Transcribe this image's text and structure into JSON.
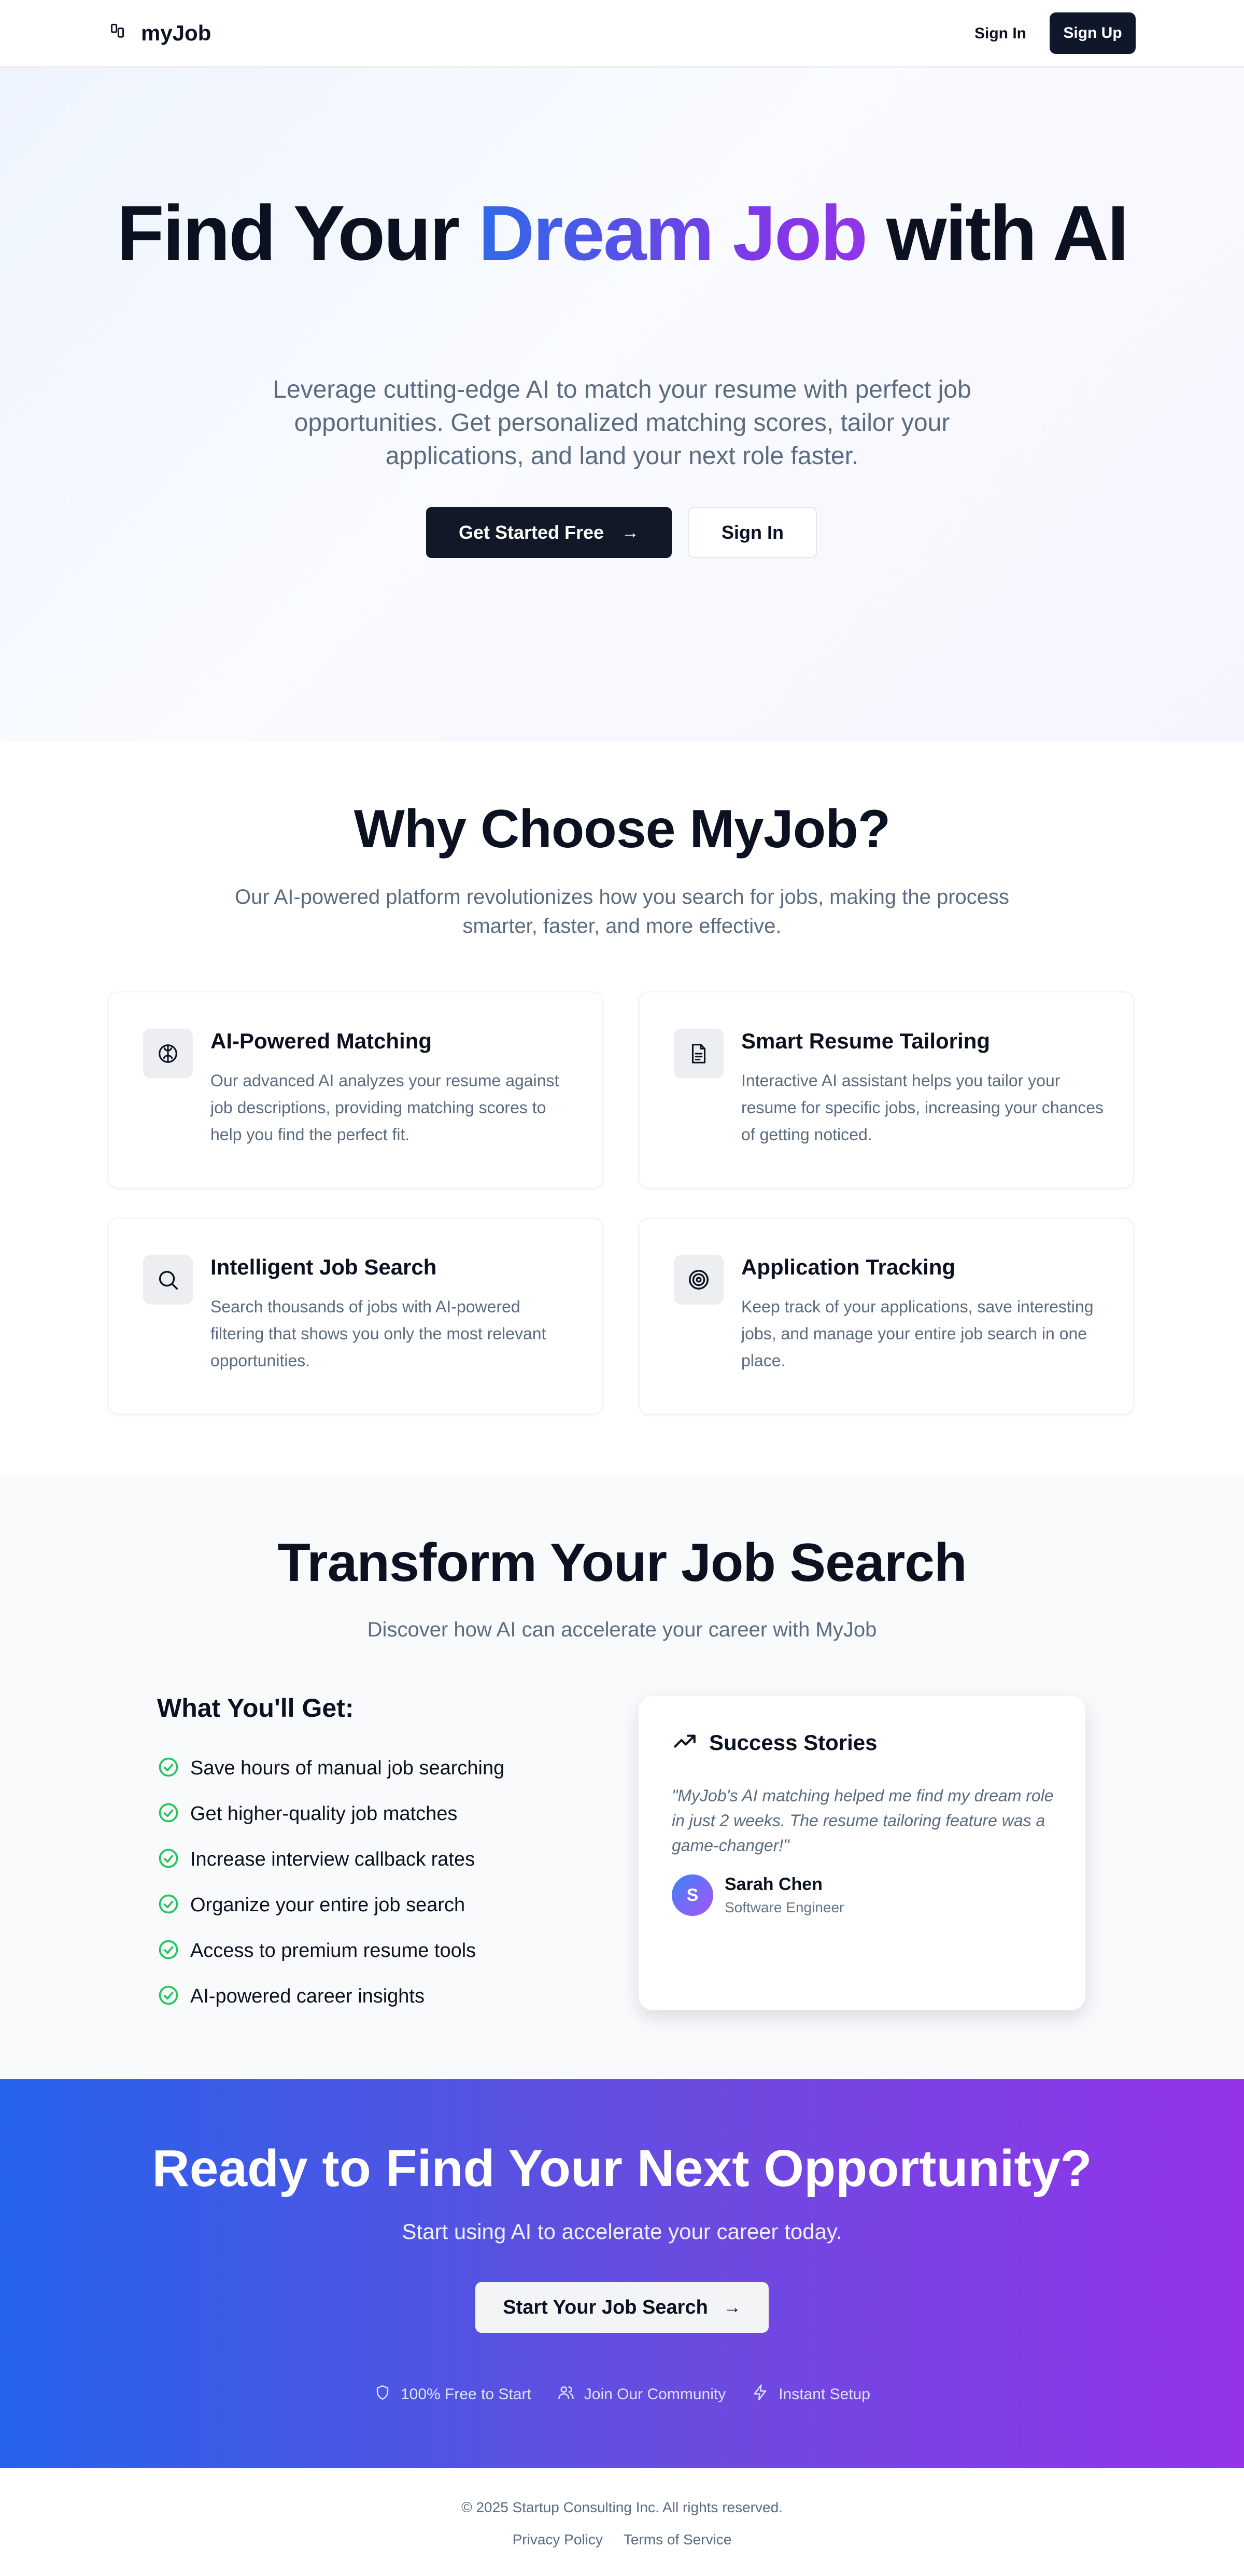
{
  "header": {
    "brand": "myJob",
    "sign_in": "Sign In",
    "sign_up": "Sign Up"
  },
  "hero": {
    "title_part1": "Find Your ",
    "title_highlight": "Dream Job",
    "title_part2": " with AI",
    "subtitle": "Leverage cutting-edge AI to match your resume with perfect job opportunities. Get personalized matching scores, tailor your applications, and land your next role faster.",
    "primary_cta": "Get Started Free",
    "secondary_cta": "Sign In"
  },
  "features": {
    "title": "Why Choose MyJob?",
    "subtitle": "Our AI-powered platform revolutionizes how you search for jobs, making the process smarter, faster, and more effective.",
    "items": [
      {
        "icon": "brain-icon",
        "title": "AI-Powered Matching",
        "description": "Our advanced AI analyzes your resume against job descriptions, providing matching scores to help you find the perfect fit."
      },
      {
        "icon": "document-icon",
        "title": "Smart Resume Tailoring",
        "description": "Interactive AI assistant helps you tailor your resume for specific jobs, increasing your chances of getting noticed."
      },
      {
        "icon": "search-icon",
        "title": "Intelligent Job Search",
        "description": "Search thousands of jobs with AI-powered filtering that shows you only the most relevant opportunities."
      },
      {
        "icon": "target-icon",
        "title": "Application Tracking",
        "description": "Keep track of your applications, save interesting jobs, and manage your entire job search in one place."
      }
    ]
  },
  "transform": {
    "title": "Transform Your Job Search",
    "subtitle": "Discover how AI can accelerate your career with MyJob",
    "what_title": "What You'll Get:",
    "benefits": [
      "Save hours of manual job searching",
      "Get higher-quality job matches",
      "Increase interview callback rates",
      "Organize your entire job search",
      "Access to premium resume tools",
      "AI-powered career insights"
    ],
    "stories": {
      "title": "Success Stories",
      "quote": "\"MyJob's AI matching helped me find my dream role in just 2 weeks. The resume tailoring feature was a game-changer!\"",
      "avatar_initial": "S",
      "author": "Sarah Chen",
      "role": "Software Engineer"
    }
  },
  "cta": {
    "title": "Ready to Find Your Next Opportunity?",
    "subtitle": "Start using AI to accelerate your career today.",
    "button": "Start Your Job Search",
    "badges": [
      "100% Free to Start",
      "Join Our Community",
      "Instant Setup"
    ]
  },
  "footer": {
    "copyright": "© 2025 Startup Consulting Inc. All rights reserved.",
    "links": [
      "Privacy Policy",
      "Terms of Service"
    ]
  },
  "colors": {
    "dark": "#0f172a",
    "muted_text": "#5b6b80",
    "gradient_start": "#2563eb",
    "gradient_end": "#9333ea",
    "check_green": "#22c55e"
  }
}
